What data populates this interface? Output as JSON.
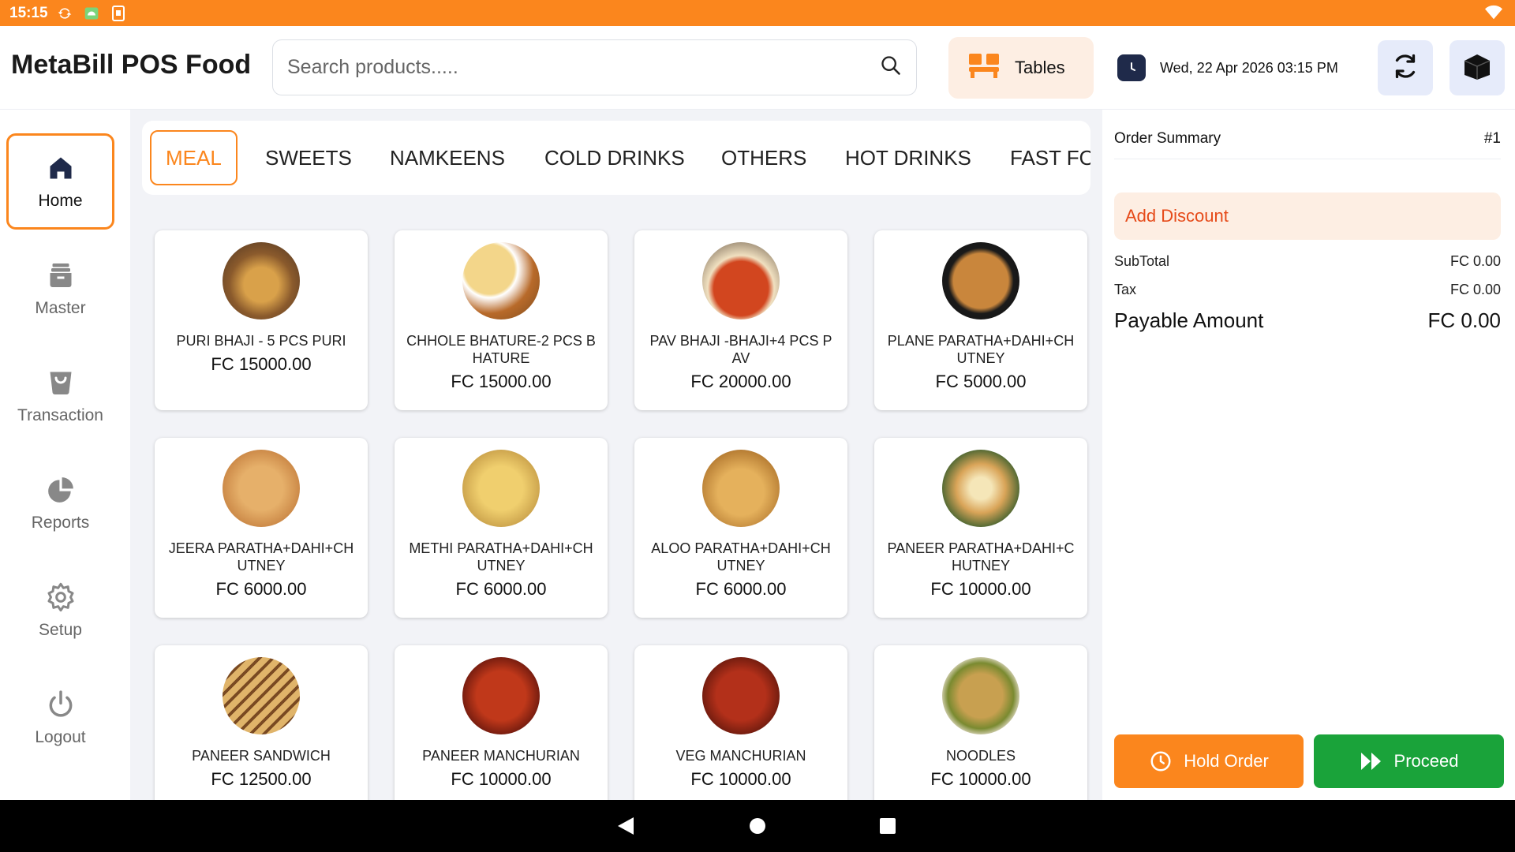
{
  "status_bar": {
    "time": "15:15",
    "icons": [
      "sync-icon",
      "android-icon",
      "sim-icon",
      "wifi-icon"
    ]
  },
  "header": {
    "title": "MetaBill POS Food",
    "search_placeholder": "Search products.....",
    "tables_label": "Tables",
    "datetime": "Wed, 22 Apr 2026 03:15 PM"
  },
  "sidebar": {
    "items": [
      {
        "label": "Home",
        "icon": "home-icon",
        "active": true
      },
      {
        "label": "Master",
        "icon": "inbox-icon"
      },
      {
        "label": "Transaction",
        "icon": "bag-icon"
      },
      {
        "label": "Reports",
        "icon": "pie-chart-icon"
      },
      {
        "label": "Setup",
        "icon": "gear-icon"
      },
      {
        "label": "Logout",
        "icon": "power-icon"
      }
    ]
  },
  "categories": [
    "MEAL",
    "SWEETS",
    "NAMKEENS",
    "COLD DRINKS",
    "OTHERS",
    "HOT DRINKS",
    "FAST FO"
  ],
  "products": [
    {
      "name": "PURI BHAJI - 5 PCS PURI",
      "price": "FC 15000.00"
    },
    {
      "name": "CHHOLE BHATURE-2 PCS BHATURE",
      "price": "FC 15000.00"
    },
    {
      "name": "PAV BHAJI -BHAJI+4 PCS PAV",
      "price": "FC 20000.00"
    },
    {
      "name": "PLANE PARATHA+DAHI+CHUTNEY",
      "price": "FC 5000.00"
    },
    {
      "name": "JEERA PARATHA+DAHI+CHUTNEY",
      "price": "FC 6000.00"
    },
    {
      "name": "METHI PARATHA+DAHI+CHUTNEY",
      "price": "FC 6000.00"
    },
    {
      "name": "ALOO PARATHA+DAHI+CHUTNEY",
      "price": "FC 6000.00"
    },
    {
      "name": "PANEER PARATHA+DAHI+CHUTNEY",
      "price": "FC 10000.00"
    },
    {
      "name": "PANEER SANDWICH",
      "price": "FC 12500.00"
    },
    {
      "name": "PANEER MANCHURIAN",
      "price": "FC 10000.00"
    },
    {
      "name": "VEG MANCHURIAN",
      "price": "FC 10000.00"
    },
    {
      "name": "NOODLES",
      "price": "FC 10000.00"
    }
  ],
  "order_summary": {
    "title": "Order Summary",
    "order_no": "#1",
    "add_discount": "Add Discount",
    "subtotal_label": "SubTotal",
    "subtotal_value": "FC 0.00",
    "tax_label": "Tax",
    "tax_value": "FC 0.00",
    "payable_label": "Payable Amount",
    "payable_value": "FC 0.00",
    "hold_label": "Hold Order",
    "proceed_label": "Proceed"
  },
  "colors": {
    "accent": "#fb861d",
    "success": "#1aa33a",
    "danger": "#e64a19",
    "navy": "#1f2a4a"
  }
}
